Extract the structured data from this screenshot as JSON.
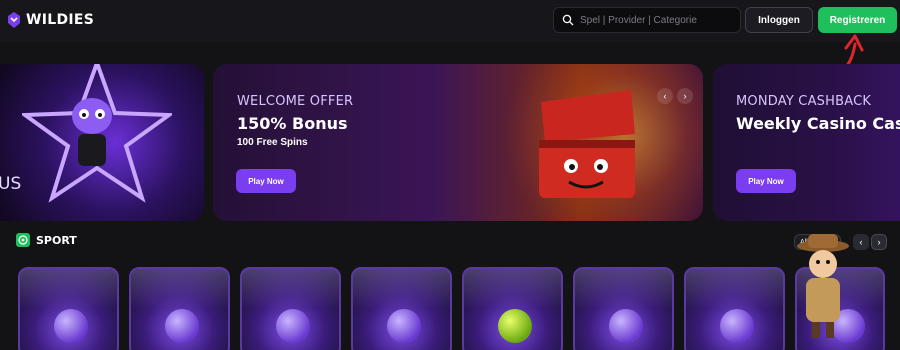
{
  "header": {
    "brand": "WILDIES",
    "search_placeholder": "Spel | Provider | Categorie",
    "login_label": "Inloggen",
    "register_label": "Registreren"
  },
  "banners": {
    "left": {
      "text_fragment": "US"
    },
    "main": {
      "eyebrow": "WELCOME OFFER",
      "headline": "150% Bonus",
      "sub": "100 Free Spins",
      "cta": "Play Now",
      "slider_prev": "‹",
      "slider_next": "›"
    },
    "right": {
      "eyebrow": "MONDAY CASHBACK",
      "headline": "Weekly Casino Cash",
      "cta": "Play Now"
    }
  },
  "sport": {
    "title": "SPORT",
    "all_link": "Alles tonen",
    "prev": "‹",
    "next": "›"
  },
  "colors": {
    "accent_green": "#1fbf5b",
    "accent_purple": "#7b3df0",
    "arrow_red": "#e0262a"
  },
  "icons": [
    "logo-icon",
    "search-icon",
    "sport-icon",
    "arrow-annotation-icon"
  ]
}
